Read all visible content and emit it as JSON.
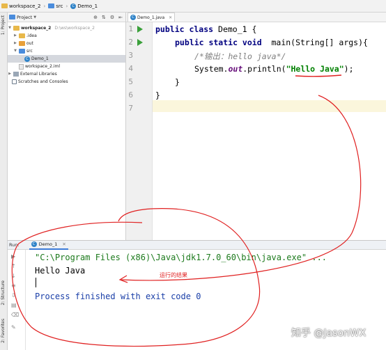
{
  "breadcrumb": {
    "items": [
      "workspace_2",
      "src",
      "Demo_1"
    ]
  },
  "left_stripe": {
    "project_tab": "1: Project",
    "structure_tab": "2: Structure",
    "favorites_tab": "2: Favorites"
  },
  "project_panel": {
    "title": "Project",
    "tree": [
      {
        "label": "workspace_2",
        "hint": "D:\\ws\\workspace_2",
        "bold": true
      },
      {
        "label": ".idea"
      },
      {
        "label": "out"
      },
      {
        "label": "src"
      },
      {
        "label": "Demo_1"
      },
      {
        "label": "workspace_2.iml"
      },
      {
        "label": "External Libraries"
      },
      {
        "label": "Scratches and Consoles"
      }
    ]
  },
  "editor": {
    "tab_label": "Demo_1.java",
    "line_numbers": [
      "1",
      "2",
      "3",
      "4",
      "5",
      "6",
      "7"
    ],
    "code": {
      "l1_kw": "public class",
      "l1_rest": " Demo_1 {",
      "l2_kw": "public static void",
      "l2_rest": "  main(String[] args){",
      "l3_comment": "/*输出：hello java*/",
      "l4_pre": "System.",
      "l4_field": "out",
      "l4_mid": ".println(",
      "l4_str": "\"Hello Java\"",
      "l4_end": ");",
      "l5": "}",
      "l6": "}"
    }
  },
  "run_panel": {
    "label": "Run:",
    "tab_label": "Demo_1",
    "console": {
      "command": "\"C:\\Program Files (x86)\\Java\\jdk1.7.0_60\\bin\\java.exe\" ...",
      "output": "Hello Java",
      "exit": "Process finished with exit code 0"
    }
  },
  "annotation": {
    "note": "运行的结果",
    "color": "#e02020"
  },
  "watermark": "知乎 @JasonWX"
}
